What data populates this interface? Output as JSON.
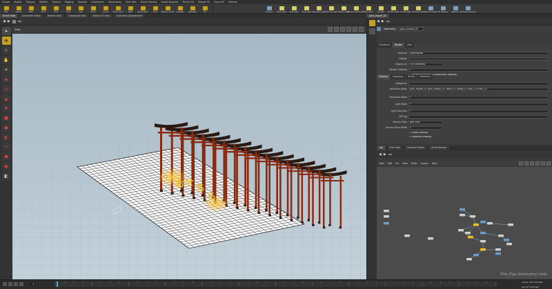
{
  "menu": [
    "Create",
    "Modify",
    "Polygon",
    "Deform",
    "Texture",
    "Rigging",
    "Muscles",
    "Characters",
    "Constraints",
    "Hair Utils",
    "Guide Process",
    "Guide Brushes",
    "Terrain FX",
    "Simple FX",
    "Cloud FX",
    "Volume"
  ],
  "shelf_left": [
    {
      "label": "Box",
      "color": "#c8a020"
    },
    {
      "label": "Sphere",
      "color": "#c8a020"
    },
    {
      "label": "Tube",
      "color": "#c8a020"
    },
    {
      "label": "Torus",
      "color": "#c8a020"
    },
    {
      "label": "Grid",
      "color": "#c8a020"
    },
    {
      "label": "Null",
      "color": "#c8a020"
    },
    {
      "label": "Line",
      "color": "#c8a020"
    },
    {
      "label": "Circle",
      "color": "#c8a020"
    },
    {
      "label": "Curve",
      "color": "#c8a020"
    },
    {
      "label": "Draw Curve",
      "color": "#c8a020"
    },
    {
      "label": "Path",
      "color": "#c8a020"
    },
    {
      "label": "Spray Paint",
      "color": "#c8a020"
    },
    {
      "label": "Font",
      "color": "#c8a020"
    },
    {
      "label": "Platonic Solids",
      "color": "#c8a020"
    },
    {
      "label": "L-System",
      "color": "#c8a020"
    },
    {
      "label": "Metaball",
      "color": "#c8a020"
    },
    {
      "label": "File",
      "color": "#c8a020"
    }
  ],
  "shelf_right": [
    {
      "label": "Camera",
      "color": "#7f9fbf"
    },
    {
      "label": "Point Light",
      "color": "#d8d060"
    },
    {
      "label": "Spot Light",
      "color": "#d8d060"
    },
    {
      "label": "Area Light",
      "color": "#d8d060"
    },
    {
      "label": "Geometry Light",
      "color": "#d8d060"
    },
    {
      "label": "Volume Light",
      "color": "#d8d060"
    },
    {
      "label": "Distant Light",
      "color": "#d8d060"
    },
    {
      "label": "Environment Light",
      "color": "#d8d060"
    },
    {
      "label": "Sky Light",
      "color": "#d8d060"
    },
    {
      "label": "GI Light",
      "color": "#d8d060"
    },
    {
      "label": "Caustic Light",
      "color": "#d8d060"
    },
    {
      "label": "Portal Light",
      "color": "#d8d060"
    },
    {
      "label": "Ambient Light",
      "color": "#d8d060"
    },
    {
      "label": "Stereo Camera",
      "color": "#7f9fbf"
    },
    {
      "label": "VR Camera",
      "color": "#7f9fbf"
    },
    {
      "label": "Switcher",
      "color": "#7f9fbf"
    },
    {
      "label": "Gamepad Camera",
      "color": "#7f9fbf"
    }
  ],
  "left_tabs": [
    "Scene View",
    "Animation Editor",
    "Render View",
    "Composite View",
    "Motion FX View",
    "Geometry Spreadsheet"
  ],
  "right_tabs": [
    "pyro_import_02"
  ],
  "path": {
    "node": "obj"
  },
  "viewer": {
    "title": "View"
  },
  "params": {
    "node_type": "Geometry",
    "node_name": "pyro_import_02",
    "tabs": [
      "Transform",
      "Render",
      "Misc"
    ],
    "active_tab": "Render",
    "sub_tabs": [
      "Shading",
      "Sampling",
      "Dicing",
      "Geometry"
    ],
    "rows": [
      {
        "label": "Material",
        "value": "/mat/flames"
      },
      {
        "label": "Display",
        "value": ""
      },
      {
        "label": "Display As",
        "value": "Full Geometry"
      },
      {
        "label": "Render Visibility",
        "value": "*"
      },
      {
        "label": "",
        "value": "Render Polygons As Subdivision (Mantra)"
      },
      {
        "label": "Categories",
        "value": ""
      },
      {
        "label": "Reflection Mask",
        "value": "pyro_import_02 pyro_import_01 Stand_02 Stand_01 Rub1_01 Rub1_01"
      },
      {
        "label": "Refraction Mask",
        "value": "*"
      },
      {
        "label": "Light Mask",
        "value": "*"
      },
      {
        "label": "Light Selection",
        "value": "*"
      },
      {
        "label": "LPE Tag",
        "value": ""
      },
      {
        "label": "Volume Filter",
        "value": "Box Filter"
      },
      {
        "label": "Volume Filter Width",
        "value": "1"
      },
      {
        "label": "",
        "value": "Matte shading"
      },
      {
        "label": "",
        "value": "Raytrace Shading"
      }
    ]
  },
  "network": {
    "tabs": [
      "obj",
      "Tree View",
      "Material Palette",
      "Asset Browser"
    ],
    "path": "obj",
    "menu": [
      "Add",
      "Edit",
      "Go",
      "View",
      "Tools",
      "Layout",
      "Help"
    ],
    "label": "Title_Eigs (Geometry) node"
  },
  "timeline": {
    "frame": "1",
    "status": "0 keys, 0/0 channels",
    "key_all": "Key All Channels"
  }
}
